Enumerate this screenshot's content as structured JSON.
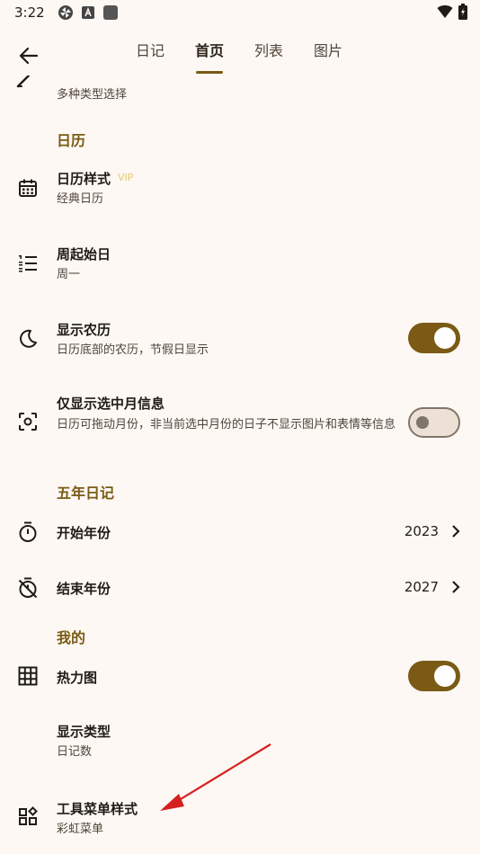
{
  "status_bar": {
    "time": "3:22"
  },
  "tabs": [
    {
      "label": "日记",
      "active": false
    },
    {
      "label": "首页",
      "active": true
    },
    {
      "label": "列表",
      "active": false
    },
    {
      "label": "图片",
      "active": false
    }
  ],
  "partial_row": {
    "subtitle": "多种类型选择"
  },
  "sections": {
    "calendar": "日历",
    "five_year": "五年日记",
    "mine": "我的"
  },
  "rows": {
    "calendar_style": {
      "title": "日历样式",
      "badge": "VIP",
      "subtitle": "经典日历",
      "icon": "calendar-icon"
    },
    "week_start": {
      "title": "周起始日",
      "subtitle": "周一",
      "icon": "list-numbered-icon"
    },
    "lunar": {
      "title": "显示农历",
      "subtitle": "日历底部的农历，节假日显示",
      "toggle": true,
      "icon": "moon-icon"
    },
    "selected_month": {
      "title": "仅显示选中月信息",
      "subtitle": "日历可拖动月份，非当前选中月份的日子不显示图片和表情等信息",
      "toggle": false,
      "icon": "focus-icon"
    },
    "start_year": {
      "title": "开始年份",
      "value": "2023",
      "icon": "timer-icon"
    },
    "end_year": {
      "title": "结束年份",
      "value": "2027",
      "icon": "timer-off-icon"
    },
    "heatmap": {
      "title": "热力图",
      "toggle": true,
      "icon": "grid-icon"
    },
    "display_type": {
      "title": "显示类型",
      "subtitle": "日记数"
    },
    "toolbar_style": {
      "title": "工具菜单样式",
      "subtitle": "彩虹菜单",
      "icon": "widgets-icon"
    }
  },
  "colors": {
    "accent": "#7a5a14",
    "background": "#fdf8f4",
    "annotation_arrow": "#d62020"
  }
}
